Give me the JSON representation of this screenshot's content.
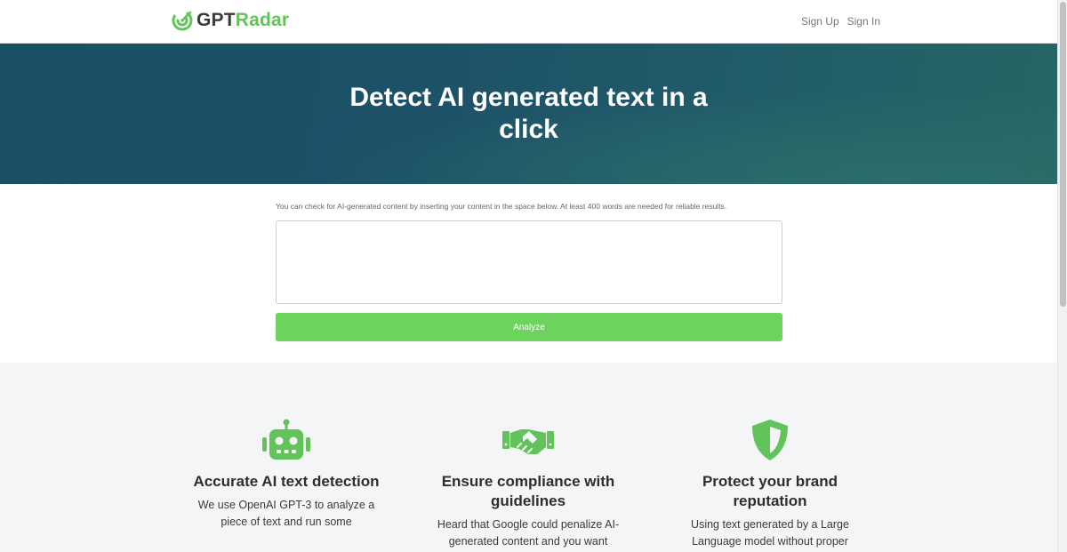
{
  "brand": {
    "gpt": "GPT",
    "radar": "Radar",
    "logo_icon": "radar-logo-icon"
  },
  "nav": {
    "signup": "Sign Up",
    "signin": "Sign In"
  },
  "hero": {
    "title": "Detect AI generated text in a click"
  },
  "form": {
    "hint": "You can check for AI-generated content by inserting your content in the space below. At least 400 words are needed for reliable results.",
    "input_value": "",
    "analyze_label": "Analyze"
  },
  "features": [
    {
      "icon": "robot-icon",
      "title": "Accurate AI text detection",
      "text": "We use OpenAI GPT-3 to analyze a piece of text and run some"
    },
    {
      "icon": "handshake-icon",
      "title": "Ensure compliance with guidelines",
      "text": "Heard that Google could penalize AI-generated content and you want"
    },
    {
      "icon": "shield-icon",
      "title": "Protect your brand reputation",
      "text": "Using text generated by a Large Language model without proper"
    }
  ],
  "colors": {
    "brand_green": "#62c35a",
    "button_green": "#6cd35c",
    "hero_dark": "#1b4f65",
    "features_bg": "#f4f5f7"
  }
}
